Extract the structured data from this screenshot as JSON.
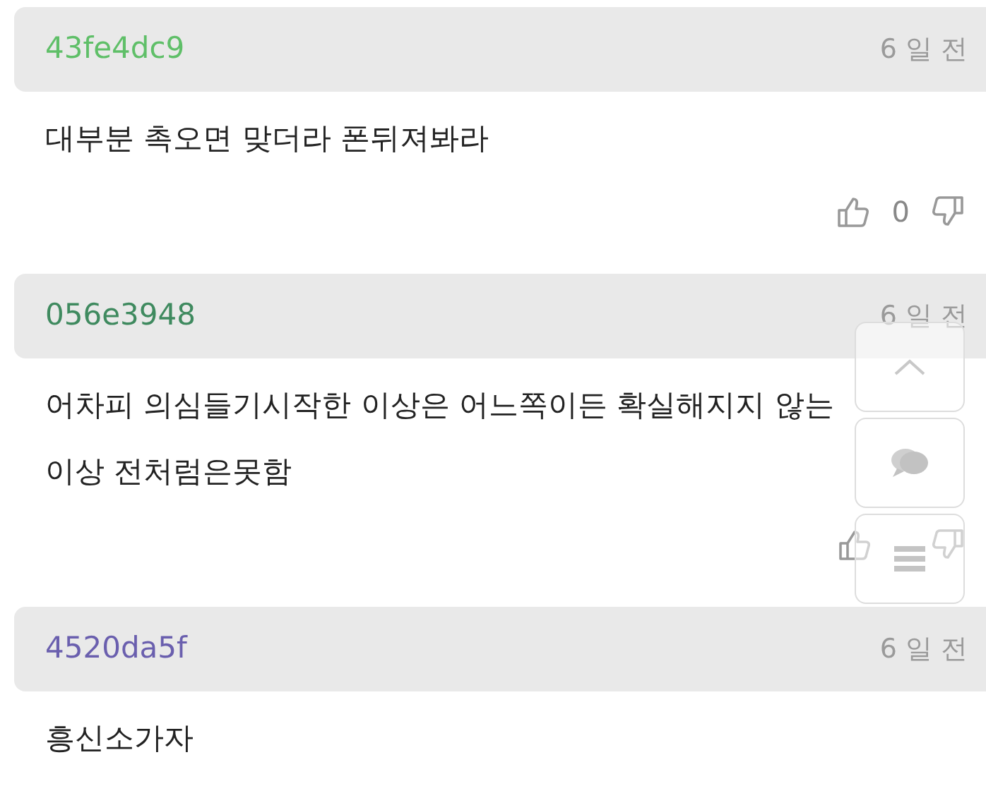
{
  "comments": [
    {
      "author": "43fe4dc9",
      "color": "#5fbf68",
      "time": "6 일 전",
      "lines": [
        "대부분 촉오면 맞더라 폰뒤져봐라"
      ],
      "votes": true,
      "likes": "0"
    },
    {
      "author": "056e3948",
      "color": "#3f8a5f",
      "time": "6 일 전",
      "lines": [
        "어차피 의심들기시작한 이상은 어느쪽이든 확실해지지 않는",
        "이상 전처럼은못함"
      ],
      "votes": true
    },
    {
      "author": "4520da5f",
      "color": "#6a5fae",
      "time": "6 일 전",
      "lines": [
        "흥신소가자"
      ]
    }
  ],
  "floating_buttons": [
    {
      "kind": "top"
    },
    {
      "kind": "comments"
    },
    {
      "kind": "list"
    }
  ]
}
